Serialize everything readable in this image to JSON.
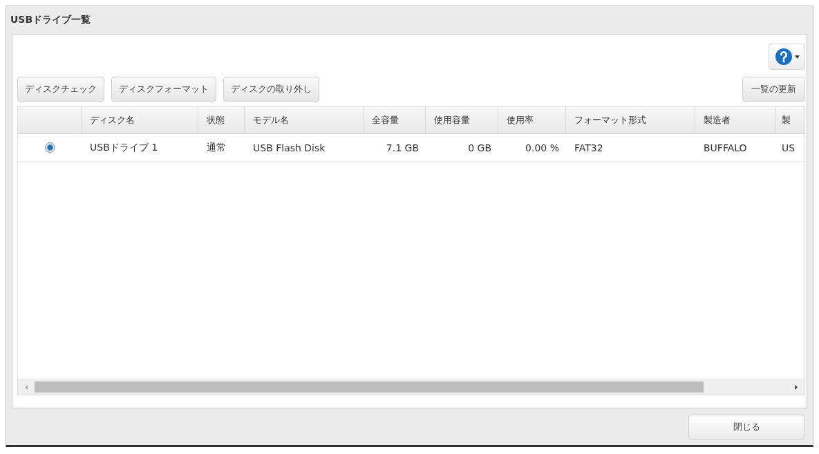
{
  "dialog": {
    "title": "USBドライブ一覧"
  },
  "toolbar": {
    "buttons": [
      "ディスクチェック",
      "ディスクフォーマット",
      "ディスクの取り外し"
    ],
    "refresh_button": "一覧の更新"
  },
  "table": {
    "columns": [
      {
        "label": "ディスク名",
        "kind": "text"
      },
      {
        "label": "状態",
        "kind": "text"
      },
      {
        "label": "モデル名",
        "kind": "text"
      },
      {
        "label": "全容量",
        "kind": "number"
      },
      {
        "label": "使用容量",
        "kind": "number"
      },
      {
        "label": "使用率",
        "kind": "number"
      },
      {
        "label": "フォーマット形式",
        "kind": "text"
      },
      {
        "label": "製造者",
        "kind": "text"
      },
      {
        "label": "製",
        "kind": "text"
      }
    ],
    "rows": [
      {
        "selected": true,
        "cells": [
          "USBドライブ 1",
          "通常",
          "USB Flash Disk",
          "7.1 GB",
          "0 GB",
          "0.00 %",
          "FAT32",
          "BUFFALO",
          "US"
        ]
      }
    ]
  },
  "footer": {
    "close_button": "閉じる"
  }
}
